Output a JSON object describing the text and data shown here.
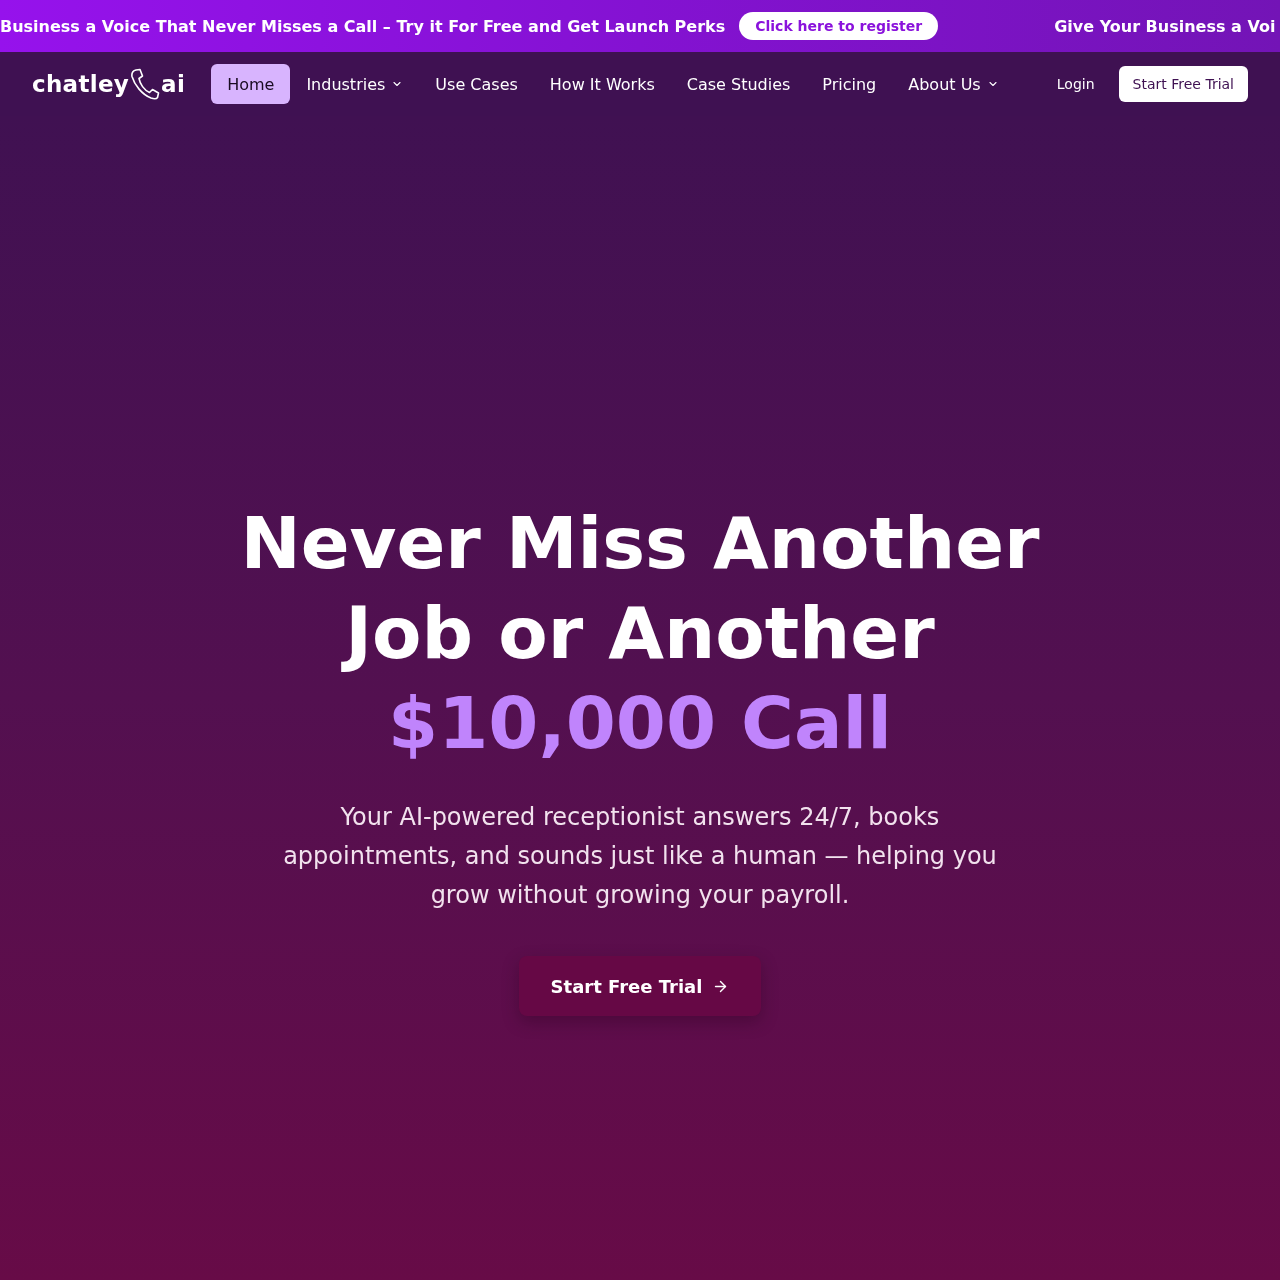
{
  "banner": {
    "messages": [
      {
        "text": "Business a Voice That Never Misses a Call – Try it For Free and Get Launch Perks",
        "link": "Click here to register"
      },
      {
        "text": "Give Your Business a Voi"
      }
    ]
  },
  "nav": {
    "logo": {
      "name": "chatley",
      "suffix": "ai"
    },
    "items": [
      {
        "label": "Home",
        "selected": true,
        "dropdown": false
      },
      {
        "label": "Industries",
        "selected": false,
        "dropdown": true
      },
      {
        "label": "Use Cases",
        "selected": false,
        "dropdown": false
      },
      {
        "label": "How It Works",
        "selected": false,
        "dropdown": false
      },
      {
        "label": "Case Studies",
        "selected": false,
        "dropdown": false
      },
      {
        "label": "Pricing",
        "selected": false,
        "dropdown": false
      },
      {
        "label": "About Us",
        "selected": false,
        "dropdown": true
      }
    ],
    "login": "Login",
    "cta": "Start Free Trial"
  },
  "hero": {
    "title": "Never Miss Another Job or Another",
    "highlight": "$10,000 Call",
    "subtitle": "Your AI-powered receptionist answers 24/7, books appointments, and sounds just like a human — helping you grow without growing your payroll.",
    "cta": "Start Free Trial"
  }
}
